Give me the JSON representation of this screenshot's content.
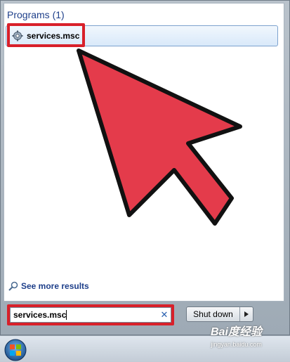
{
  "programs": {
    "header": "Programs (1)",
    "results": [
      {
        "label": "services.msc",
        "icon": "gear-icon"
      }
    ]
  },
  "see_more": {
    "label": "See more results",
    "icon": "search-icon"
  },
  "search": {
    "value": "services.msc"
  },
  "shutdown": {
    "label": "Shut down"
  },
  "watermark": {
    "logo": "Bai度经验",
    "url": "jingyan.baidu.com"
  },
  "colors": {
    "highlight": "#d8202a",
    "arrow_fill": "#e43b4b",
    "header_text": "#1e3f8a"
  }
}
